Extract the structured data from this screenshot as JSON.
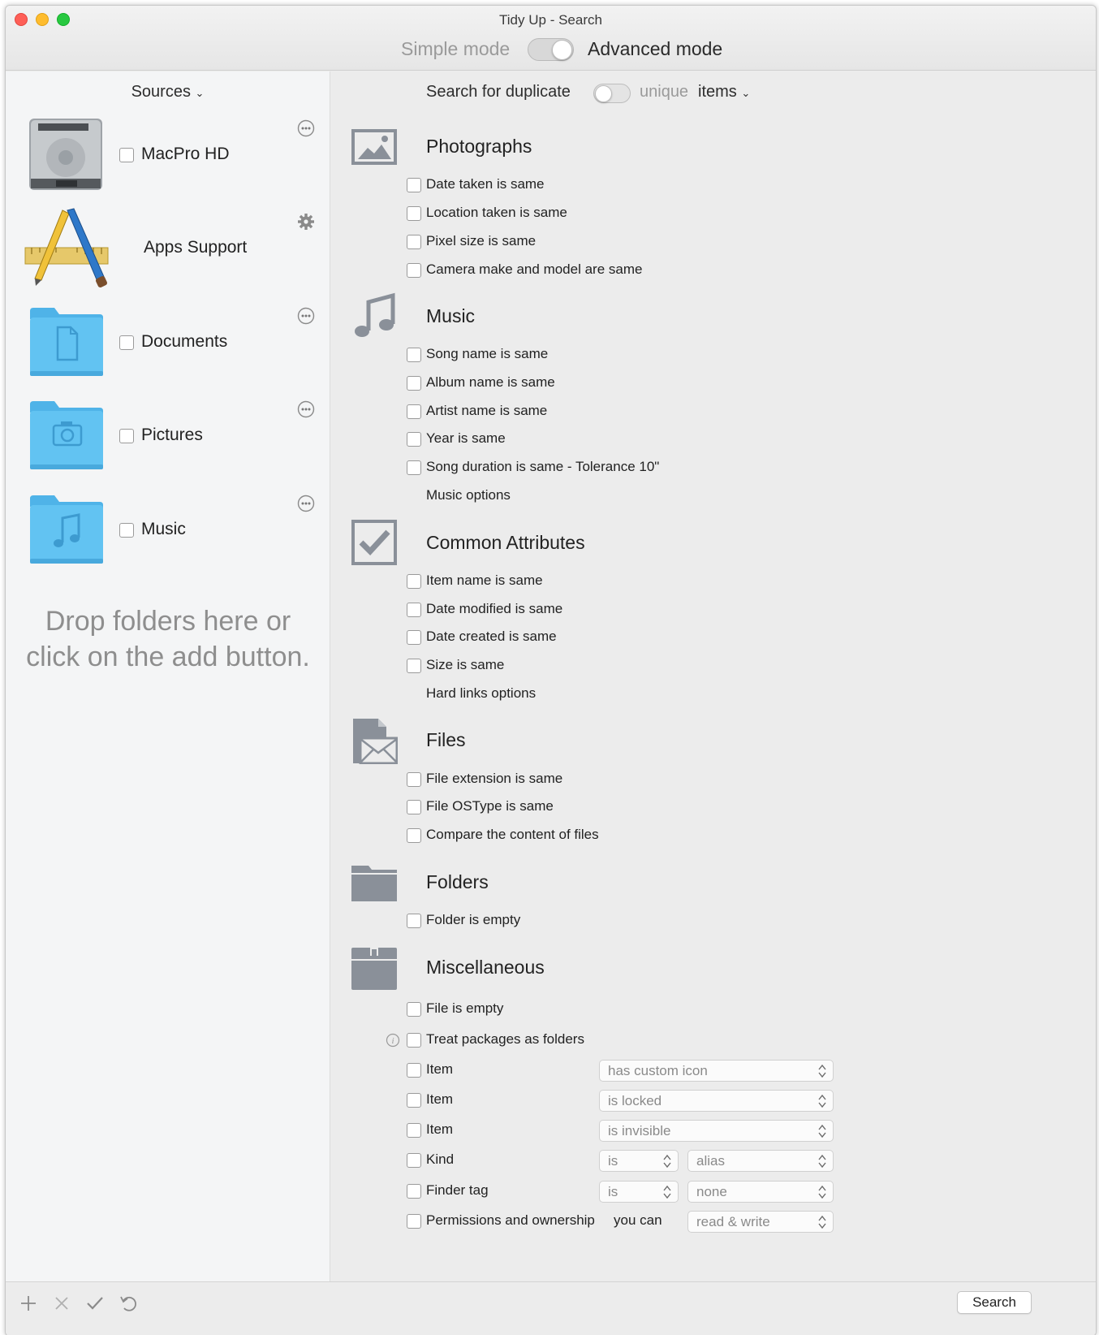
{
  "window": {
    "title": "Tidy Up - Search",
    "mode": {
      "simple_label": "Simple mode",
      "advanced_label": "Advanced mode",
      "selected": "Advanced mode"
    }
  },
  "sidebar": {
    "header": "Sources",
    "sources": [
      {
        "label": "MacPro HD",
        "icon": "hard-drive-icon",
        "checked": false,
        "action_icon": "more-icon"
      },
      {
        "label": "Apps Support",
        "icon": "app-store-icon",
        "action_icon": "gear-icon"
      },
      {
        "label": "Documents",
        "icon": "documents-folder-icon",
        "checked": false,
        "action_icon": "more-icon"
      },
      {
        "label": "Pictures",
        "icon": "pictures-folder-icon",
        "checked": false,
        "action_icon": "more-icon"
      },
      {
        "label": "Music",
        "icon": "music-folder-icon",
        "checked": false,
        "action_icon": "more-icon"
      }
    ],
    "drop_hint_line1": "Drop folders here or",
    "drop_hint_line2": "click on the add button."
  },
  "main": {
    "search_for": {
      "prefix": "Search for duplicate",
      "unique": "unique",
      "suffix": "items",
      "toggle_on": false
    },
    "categories": {
      "photographs": {
        "title": "Photographs",
        "icon": "photo-icon",
        "options": [
          "Date taken is same",
          "Location taken is same",
          "Pixel size is same",
          "Camera make and model are same"
        ]
      },
      "music": {
        "title": "Music",
        "icon": "music-note-icon",
        "options": [
          "Song name is same",
          "Album name is same",
          "Artist name is same",
          "Year is same",
          "Song duration is same - Tolerance 10\""
        ],
        "extra": "Music options"
      },
      "common": {
        "title": "Common Attributes",
        "icon": "checkmark-box-icon",
        "options": [
          "Item name is same",
          "Date modified is same",
          "Date created is same",
          "Size is same"
        ],
        "extra": "Hard links options"
      },
      "files": {
        "title": "Files",
        "icon": "file-envelope-icon",
        "options": [
          "File extension is same",
          "File OSType is same",
          "Compare the content of files"
        ]
      },
      "folders": {
        "title": "Folders",
        "icon": "folder-icon",
        "options": [
          "Folder is empty"
        ]
      },
      "misc": {
        "title": "Miscellaneous",
        "icon": "box-icon",
        "options": [
          "File is empty",
          "Treat packages as folders"
        ],
        "rows": [
          {
            "label": "Item",
            "select1": "has custom icon"
          },
          {
            "label": "Item",
            "select1": "is locked"
          },
          {
            "label": "Item",
            "select1": "is invisible"
          },
          {
            "label": "Kind",
            "select1": "is",
            "select2": "alias"
          },
          {
            "label": "Finder tag",
            "select1": "is",
            "select2": "none"
          },
          {
            "label": "Permissions and ownership",
            "middle": "you can",
            "select2": "read & write"
          }
        ]
      }
    }
  },
  "bottom": {
    "search_button": "Search"
  },
  "colors": {
    "folder_blue": "#5fc0f2",
    "icon_gray": "#8a9099",
    "close": "#fe5f57",
    "minimize": "#febc2e",
    "zoom": "#28c840"
  }
}
